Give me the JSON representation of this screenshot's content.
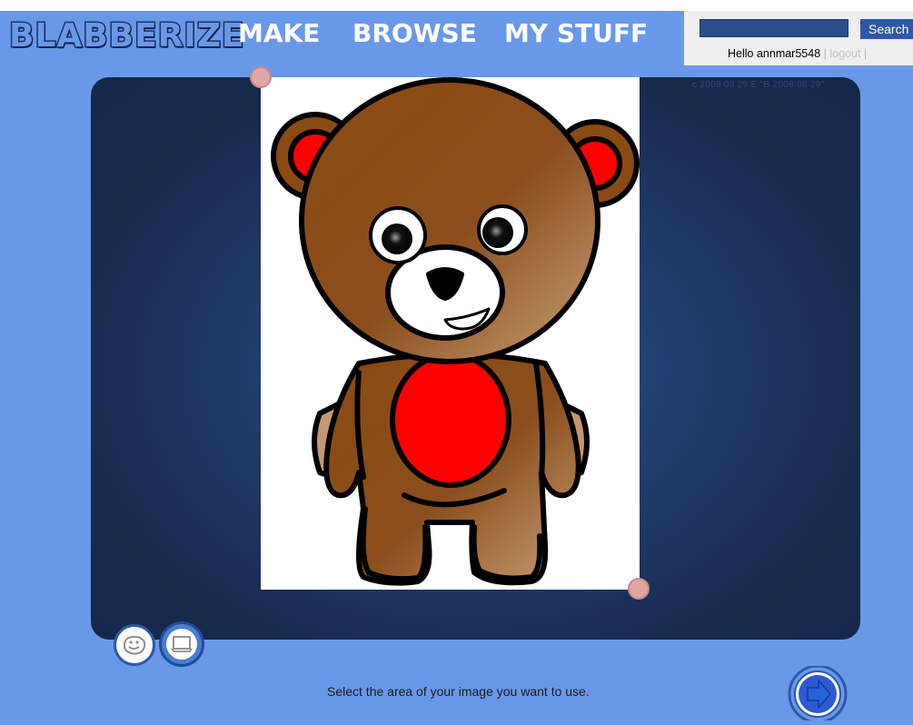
{
  "header": {
    "logo_text": "BLABBERIZE",
    "nav": {
      "make": "MAKE",
      "browse": "BROWSE",
      "my_stuff": "MY STUFF"
    }
  },
  "userbox": {
    "search_value": "",
    "search_button": "Search",
    "hello": "Hello annmar5548",
    "separator": "|",
    "logout": "logout"
  },
  "stage": {
    "caption": "c 2008 08 29   E \"B 2008 08 29\"",
    "image_name": "teddy-bear"
  },
  "tools": {
    "face": "face-tool",
    "crop": "crop-tool"
  },
  "footer": {
    "instruction": "Select the area of your image you want to use.",
    "next_icon": "arrow-right-icon"
  },
  "colors": {
    "background": "#6a98e8",
    "stage": "#172a4c",
    "handle": "#e2a5a5",
    "accent": "#2d59a8"
  }
}
